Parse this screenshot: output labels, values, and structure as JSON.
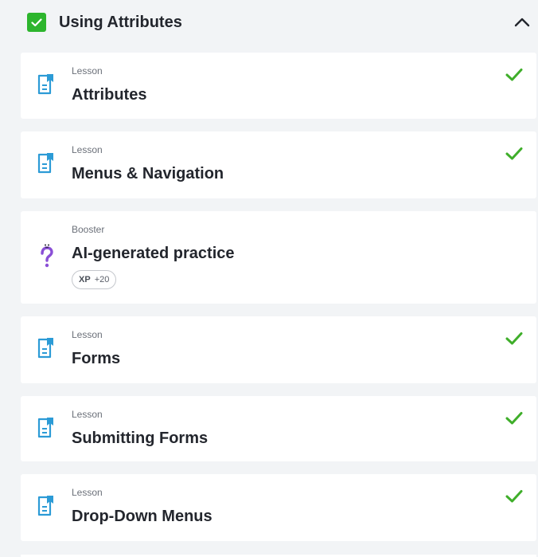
{
  "section": {
    "title": "Using Attributes",
    "completed": true,
    "check_color": "#2db52d",
    "expanded": true
  },
  "colors": {
    "lesson_icon": "#2c9bd6",
    "booster_icon": "#8a4fd6",
    "done_check": "#3fae2a"
  },
  "items": [
    {
      "type": "Lesson",
      "title": "Attributes",
      "icon": "document-icon",
      "completed": true
    },
    {
      "type": "Lesson",
      "title": "Menus & Navigation",
      "icon": "document-icon",
      "completed": true
    },
    {
      "type": "Booster",
      "title": "AI-generated practice",
      "icon": "question-mark-icon",
      "completed": false,
      "xp_label": "XP",
      "xp_value": "+20"
    },
    {
      "type": "Lesson",
      "title": "Forms",
      "icon": "document-icon",
      "completed": true
    },
    {
      "type": "Lesson",
      "title": "Submitting Forms",
      "icon": "document-icon",
      "completed": true
    },
    {
      "type": "Lesson",
      "title": "Drop-Down Menus",
      "icon": "document-icon",
      "completed": true
    }
  ]
}
